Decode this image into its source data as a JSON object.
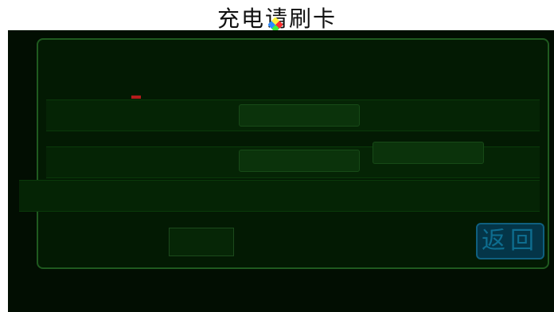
{
  "header": {
    "title": "充电请刷卡"
  },
  "buttons": {
    "back_label": "返回"
  },
  "colors": {
    "screen_bg": "#020e02",
    "panel_border": "#1f5a1f",
    "back_button": "#0e6d8f"
  }
}
